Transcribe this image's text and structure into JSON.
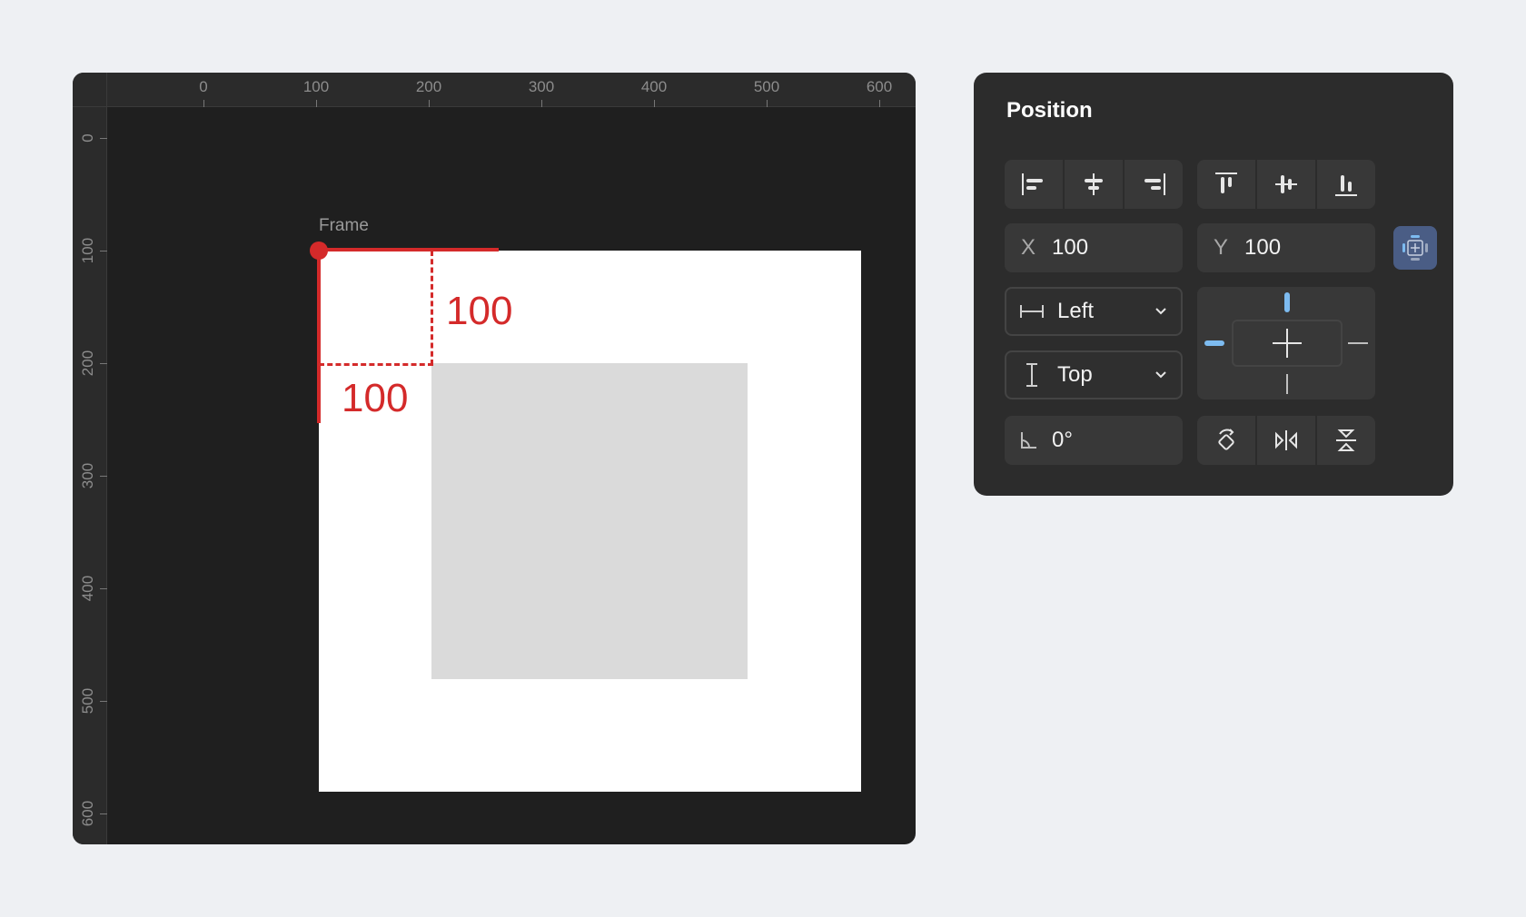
{
  "canvas": {
    "ruler_top_labels": [
      "0",
      "100",
      "200",
      "300",
      "400",
      "500",
      "600"
    ],
    "ruler_left_labels": [
      "0",
      "100",
      "200",
      "300",
      "400",
      "500",
      "600"
    ],
    "frame_label": "Frame",
    "offset_x_label": "100",
    "offset_y_label": "100",
    "colors": {
      "background": "#1f1f1f",
      "frame": "#ffffff",
      "child": "#dadada",
      "measure": "#d42a2a"
    }
  },
  "panel": {
    "title": "Position",
    "align_horizontal": [
      {
        "icon": "align-left-icon"
      },
      {
        "icon": "align-horizontal-center-icon"
      },
      {
        "icon": "align-right-icon"
      }
    ],
    "align_vertical": [
      {
        "icon": "align-top-icon"
      },
      {
        "icon": "align-vertical-center-icon"
      },
      {
        "icon": "align-bottom-icon"
      }
    ],
    "x": {
      "prefix": "X",
      "value": "100"
    },
    "y": {
      "prefix": "Y",
      "value": "100"
    },
    "horizontal_constraint": {
      "value": "Left",
      "icon": "horizontal-constraint-icon"
    },
    "vertical_constraint": {
      "value": "Top",
      "icon": "vertical-constraint-icon"
    },
    "rotation": {
      "value": "0°",
      "icon": "angle-icon"
    },
    "transform_buttons": [
      {
        "icon": "rotate-icon"
      },
      {
        "icon": "flip-horizontal-icon"
      },
      {
        "icon": "flip-vertical-icon"
      }
    ],
    "accent": "#7dbbf0"
  }
}
